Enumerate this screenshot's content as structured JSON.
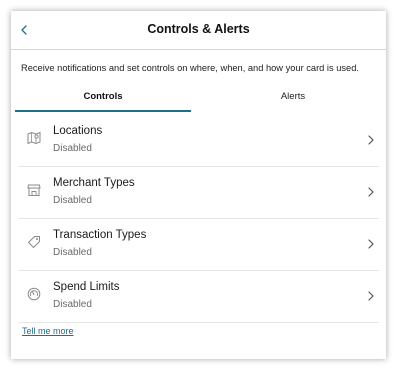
{
  "header": {
    "title": "Controls & Alerts",
    "back_icon": "chevron-left-icon"
  },
  "description": "Receive notifications and set controls on where, when, and how your card is used.",
  "tabs": [
    {
      "label": "Controls",
      "active": true
    },
    {
      "label": "Alerts",
      "active": false
    }
  ],
  "items": [
    {
      "label": "Locations",
      "status": "Disabled",
      "icon": "map-icon"
    },
    {
      "label": "Merchant Types",
      "status": "Disabled",
      "icon": "storefront-icon"
    },
    {
      "label": "Transaction Types",
      "status": "Disabled",
      "icon": "tag-icon"
    },
    {
      "label": "Spend Limits",
      "status": "Disabled",
      "icon": "gauge-icon"
    }
  ],
  "link": {
    "label": "Tell me more"
  },
  "colors": {
    "accent": "#1e6f8c",
    "muted_text": "#6a6a6a",
    "divider": "#e6e6e6"
  }
}
